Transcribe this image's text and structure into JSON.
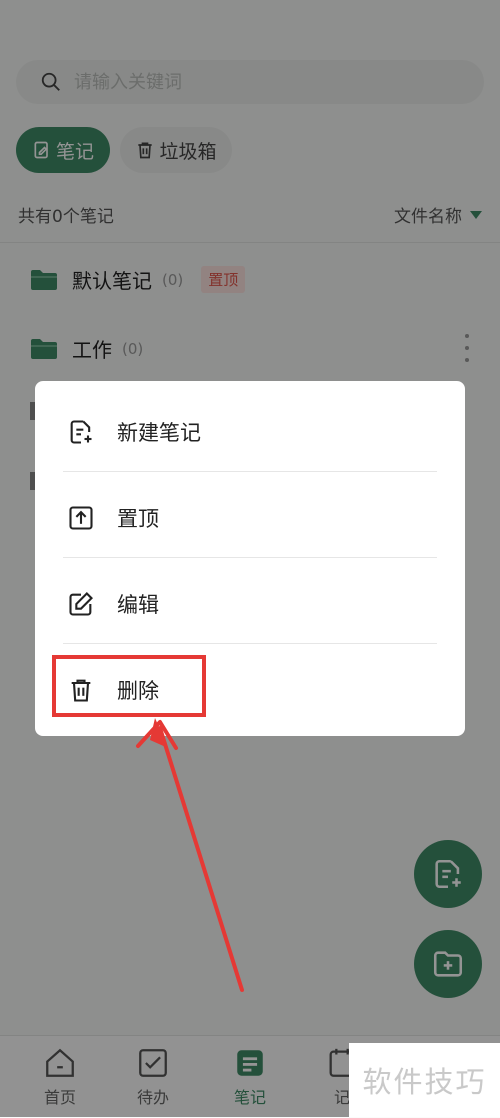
{
  "search": {
    "placeholder": "请输入关键词"
  },
  "tabs": [
    {
      "label": "笔记",
      "active": true
    },
    {
      "label": "垃圾箱",
      "active": false
    }
  ],
  "summary": {
    "count_text": "共有0个笔记",
    "sort_label": "文件名称"
  },
  "folders": [
    {
      "name": "默认笔记",
      "count": "(0)",
      "badge": "置顶"
    },
    {
      "name": "工作",
      "count": "(0)"
    }
  ],
  "context_menu": {
    "items": [
      {
        "label": "新建笔记",
        "icon": "new-note-icon"
      },
      {
        "label": "置顶",
        "icon": "pin-top-icon"
      },
      {
        "label": "编辑",
        "icon": "edit-icon"
      },
      {
        "label": "删除",
        "icon": "trash-icon"
      }
    ]
  },
  "bottom_nav": [
    {
      "label": "首页",
      "icon": "home-icon"
    },
    {
      "label": "待办",
      "icon": "todo-icon"
    },
    {
      "label": "笔记",
      "icon": "note-icon",
      "active": true
    },
    {
      "label": "记",
      "icon": "ledger-icon"
    }
  ],
  "watermark": "软件技巧",
  "colors": {
    "accent": "#3f8a66",
    "highlight": "#e53935",
    "badge_text": "#e2574c"
  }
}
